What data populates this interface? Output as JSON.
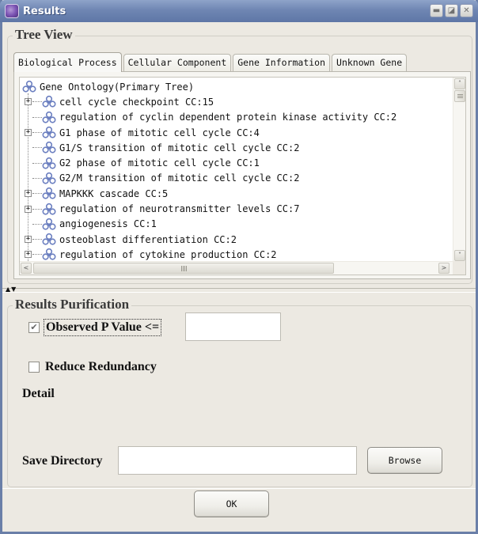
{
  "window": {
    "title": "Results",
    "app_icon": "app-logo-icon",
    "controls": [
      {
        "name": "minimize",
        "glyph": "▬"
      },
      {
        "name": "maximize",
        "glyph": "◪"
      },
      {
        "name": "close",
        "glyph": "✕"
      }
    ]
  },
  "tree_view": {
    "group_title": "Tree View",
    "tabs": [
      {
        "label": "Biological Process",
        "active": true
      },
      {
        "label": "Cellular Component",
        "active": false
      },
      {
        "label": "Gene Information",
        "active": false
      },
      {
        "label": "Unknown Gene",
        "active": false
      }
    ],
    "root": {
      "label": "Gene Ontology(Primary Tree)",
      "icon": "biohazard-icon"
    },
    "nodes": [
      {
        "label": "cell cycle checkpoint CC:15",
        "expandable": true
      },
      {
        "label": "regulation of cyclin dependent protein kinase activity CC:2",
        "expandable": false
      },
      {
        "label": "G1 phase of mitotic cell cycle CC:4",
        "expandable": true
      },
      {
        "label": "G1/S transition of mitotic cell cycle CC:2",
        "expandable": false
      },
      {
        "label": "G2 phase of mitotic cell cycle CC:1",
        "expandable": false
      },
      {
        "label": "G2/M transition of mitotic cell cycle CC:2",
        "expandable": false
      },
      {
        "label": "MAPKKK cascade CC:5",
        "expandable": true
      },
      {
        "label": "regulation of neurotransmitter levels CC:7",
        "expandable": true
      },
      {
        "label": "angiogenesis CC:1",
        "expandable": false
      },
      {
        "label": "osteoblast differentiation CC:2",
        "expandable": true
      },
      {
        "label": "regulation of cytokine production CC:2",
        "expandable": true
      }
    ],
    "expand_glyph": "+",
    "scroll_up": "˄",
    "scroll_down": "˅",
    "scroll_left": "<",
    "scroll_right": ">"
  },
  "splitter": {
    "arrows": "▲▼"
  },
  "purification": {
    "group_title": "Results Purification",
    "p_value": {
      "label": "Observed P Value <=",
      "checked": true,
      "check_glyph": "✔",
      "value": ""
    },
    "reduce_redundancy": {
      "label": "Reduce Redundancy",
      "checked": false
    },
    "detail_label": "Detail",
    "save_directory": {
      "label": "Save Directory",
      "value": ""
    },
    "browse_label": "Browse"
  },
  "footer": {
    "ok_label": "OK"
  },
  "colors": {
    "titlebar": "#6f86b3",
    "window_bg": "#ece9e2",
    "tree_icon": "#6b7fc0"
  }
}
